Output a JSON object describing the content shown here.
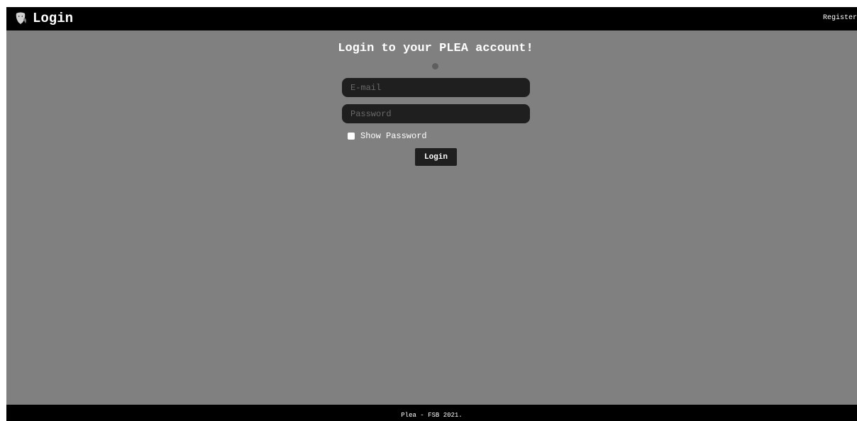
{
  "header": {
    "logo_icon": "mask-icon",
    "title": "Login",
    "register_label": "Register"
  },
  "main": {
    "heading": "Login to your PLEA account!",
    "email_placeholder": "E-mail",
    "email_value": "",
    "password_placeholder": "Password",
    "password_value": "",
    "show_password_label": "Show Password",
    "show_password_checked": false,
    "login_label": "Login"
  },
  "footer": {
    "text": "Plea - FSB 2021."
  },
  "colors": {
    "page_background": "#808080",
    "bar_background": "#000000",
    "field_background": "#1f1f1f",
    "text": "#ffffff"
  }
}
